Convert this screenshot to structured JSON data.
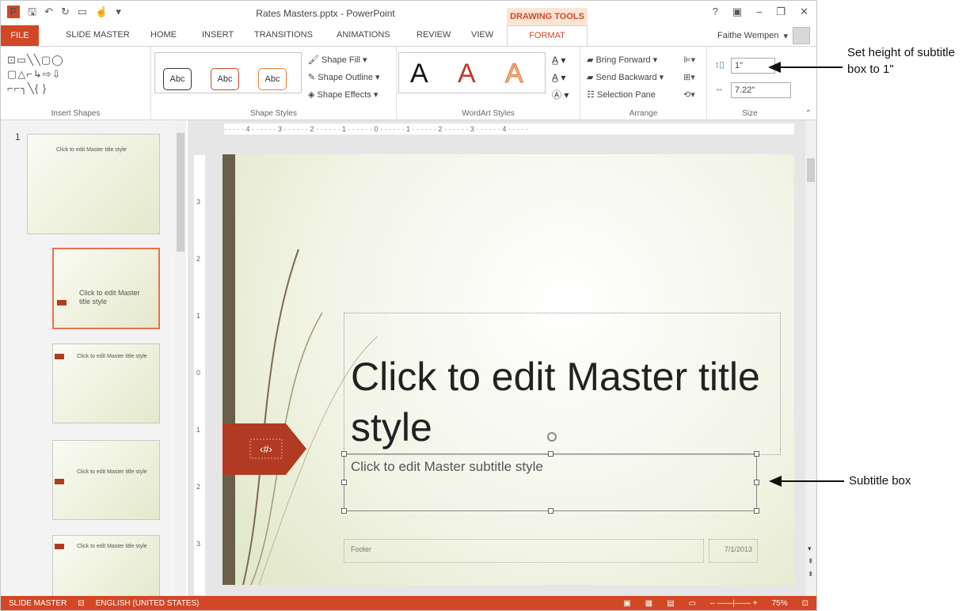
{
  "window": {
    "title": "Rates Masters.pptx - PowerPoint",
    "contextual_tab": "DRAWING TOOLS",
    "help": "?",
    "controls": [
      "▣",
      "–",
      "❐",
      "✕"
    ]
  },
  "tabs": [
    "FILE",
    "SLIDE MASTER",
    "HOME",
    "INSERT",
    "TRANSITIONS",
    "ANIMATIONS",
    "REVIEW",
    "VIEW",
    "FORMAT"
  ],
  "user": {
    "name": "Faithe Wempen"
  },
  "ribbon": {
    "groups": [
      "Insert Shapes",
      "Shape Styles",
      "WordArt Styles",
      "Arrange",
      "Size"
    ],
    "shape_style_samples": [
      "Abc",
      "Abc",
      "Abc"
    ],
    "shape_commands": [
      "Shape Fill ▾",
      "Shape Outline ▾",
      "Shape Effects ▾"
    ],
    "wordart_samples": [
      "A",
      "A",
      "A"
    ],
    "arrange_commands": [
      "Bring Forward ▾",
      "Send Backward ▾",
      "Selection Pane"
    ],
    "size": {
      "height": "1\"",
      "width": "7.22\""
    }
  },
  "thumbnails": [
    {
      "number": "1",
      "label": "Click to edit Master title style"
    },
    {
      "label": "Click to edit Master title style"
    },
    {
      "label": "Click to edit Master title style"
    },
    {
      "label": "Click to edit Master title style"
    },
    {
      "label": "Click to edit Master title style"
    }
  ],
  "ruler": {
    "h": "· · · · · 4 · · · · · · 3 · · · · · · 2 · · · · · · 1 · · · · · · 0 · · · · · · 1 · · · · · · 2 · · · · · · 3 · · · · · · 4 · · · · ·",
    "v": [
      "3",
      "2",
      "1",
      "0",
      "1",
      "2",
      "3"
    ]
  },
  "slide": {
    "title": "Click to edit Master title style",
    "subtitle": "Click to edit Master subtitle style",
    "footer": "Footer",
    "date": "7/1/2013",
    "page_number": "‹#›"
  },
  "status": {
    "view": "SLIDE MASTER",
    "language": "ENGLISH (UNITED STATES)",
    "zoom": "75%"
  },
  "callouts": {
    "height": "Set height of subtitle box to 1\"",
    "subtitle": "Subtitle box"
  },
  "colors": {
    "accent": "#d24726",
    "tag": "#b33a22"
  }
}
